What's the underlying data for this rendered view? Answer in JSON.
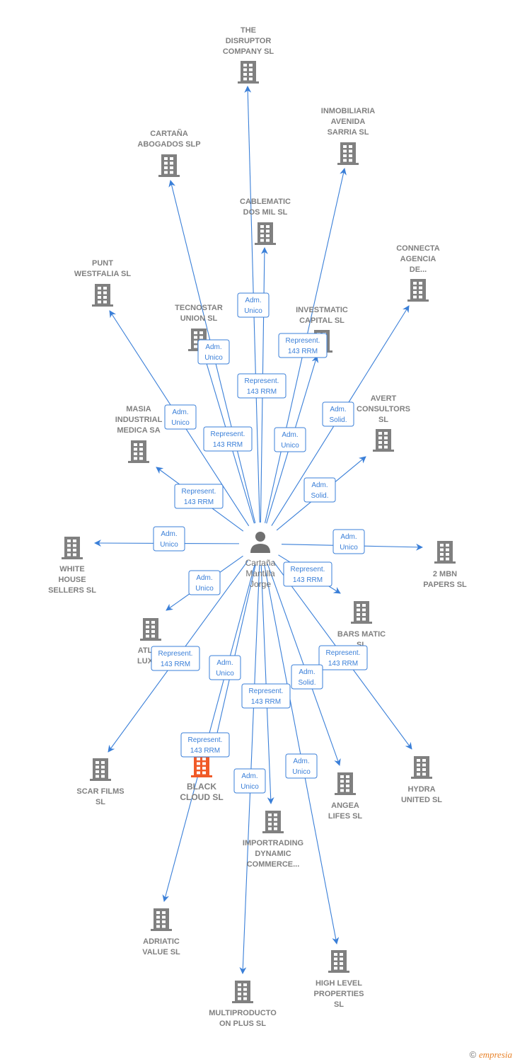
{
  "center": {
    "name_lines": [
      "Cartaña",
      "Mantilla",
      "Jorge"
    ],
    "icon": "person-icon"
  },
  "colors": {
    "edge": "#3a7fd8",
    "node": "#808080",
    "highlight": "#f05a28"
  },
  "nodes": [
    {
      "id": "disruptor",
      "lines": [
        "THE",
        "DISRUPTOR",
        "COMPANY  SL"
      ],
      "edge_label": [
        "Adm.",
        "Unico"
      ]
    },
    {
      "id": "inmobiliaria",
      "lines": [
        "INMOBILIARIA",
        "AVENIDA",
        "SARRIA  SL"
      ],
      "edge_label": [
        "Represent.",
        "143 RRM"
      ]
    },
    {
      "id": "cartana",
      "lines": [
        "CARTAÑA",
        "ABOGADOS  SLP"
      ],
      "edge_label": [
        "Represent.",
        "143 RRM"
      ]
    },
    {
      "id": "cablematic",
      "lines": [
        "CABLEMATIC",
        "DOS MIL SL"
      ],
      "edge_label": [
        "Represent.",
        "143 RRM"
      ]
    },
    {
      "id": "connecta",
      "lines": [
        "CONNECTA",
        "AGENCIA",
        "DE..."
      ],
      "edge_label": [
        "Adm.",
        "Solid."
      ]
    },
    {
      "id": "punt",
      "lines": [
        "PUNT",
        "WESTFALIA SL"
      ],
      "edge_label": [
        "Adm.",
        "Unico"
      ]
    },
    {
      "id": "tecnostar",
      "lines": [
        "TECNOSTAR",
        "UNION  SL"
      ],
      "edge_label": [
        "Adm.",
        "Unico"
      ]
    },
    {
      "id": "investmatic",
      "lines": [
        "INVESTMATIC",
        "CAPITAL  SL"
      ],
      "edge_label": [
        "Adm.",
        "Unico"
      ]
    },
    {
      "id": "avert",
      "lines": [
        "AVERT",
        "CONSULTORS",
        "SL"
      ],
      "edge_label": [
        "Adm.",
        "Solid."
      ]
    },
    {
      "id": "masia",
      "lines": [
        "MASIA",
        "INDUSTRIAL",
        "MEDICA SA"
      ],
      "edge_label": [
        "Represent.",
        "143 RRM"
      ]
    },
    {
      "id": "whitehouse",
      "lines": [
        "WHITE",
        "HOUSE",
        "SELLERS SL"
      ],
      "edge_label": [
        "Adm.",
        "Unico"
      ]
    },
    {
      "id": "mbn",
      "lines": [
        "2 MBN",
        "PAPERS SL"
      ],
      "edge_label": [
        "Adm.",
        "Unico"
      ]
    },
    {
      "id": "atla",
      "lines": [
        "ATLAN",
        "LUXUR"
      ],
      "edge_label": [
        "Adm.",
        "Unico"
      ]
    },
    {
      "id": "barsmatic",
      "lines": [
        "BARS MATIC",
        "SL"
      ],
      "edge_label": [
        "Represent.",
        "143 RRM"
      ]
    },
    {
      "id": "scar",
      "lines": [
        "SCAR FILMS",
        "SL"
      ],
      "edge_label": [
        "Represent.",
        "143 RRM"
      ]
    },
    {
      "id": "blackcloud",
      "lines": [
        "BLACK",
        "CLOUD  SL"
      ],
      "edge_label": [
        "Adm.",
        "Unico"
      ],
      "highlight": true
    },
    {
      "id": "hydra",
      "lines": [
        "HYDRA",
        "UNITED  SL"
      ],
      "edge_label": [
        "Represent.",
        "143 RRM"
      ]
    },
    {
      "id": "angea",
      "lines": [
        "ANGEA",
        "LIFES SL"
      ],
      "edge_label": [
        "Adm.",
        "Solid."
      ]
    },
    {
      "id": "importrading",
      "lines": [
        "IMPORTRADING",
        "DYNAMIC",
        "COMMERCE..."
      ],
      "edge_label": [
        "Represent.",
        "143 RRM"
      ]
    },
    {
      "id": "adriatic",
      "lines": [
        "ADRIATIC",
        "VALUE  SL"
      ],
      "edge_label": [
        "Represent.",
        "143 RRM"
      ]
    },
    {
      "id": "highlevel",
      "lines": [
        "HIGH LEVEL",
        "PROPERTIES",
        "SL"
      ],
      "edge_label": [
        "Adm.",
        "Unico"
      ]
    },
    {
      "id": "multiproducto",
      "lines": [
        "MULTIPRODUCTO",
        "ON PLUS  SL"
      ],
      "edge_label": [
        "Adm.",
        "Unico"
      ]
    }
  ],
  "footer": {
    "copyright": "©",
    "brand": "empresia"
  }
}
